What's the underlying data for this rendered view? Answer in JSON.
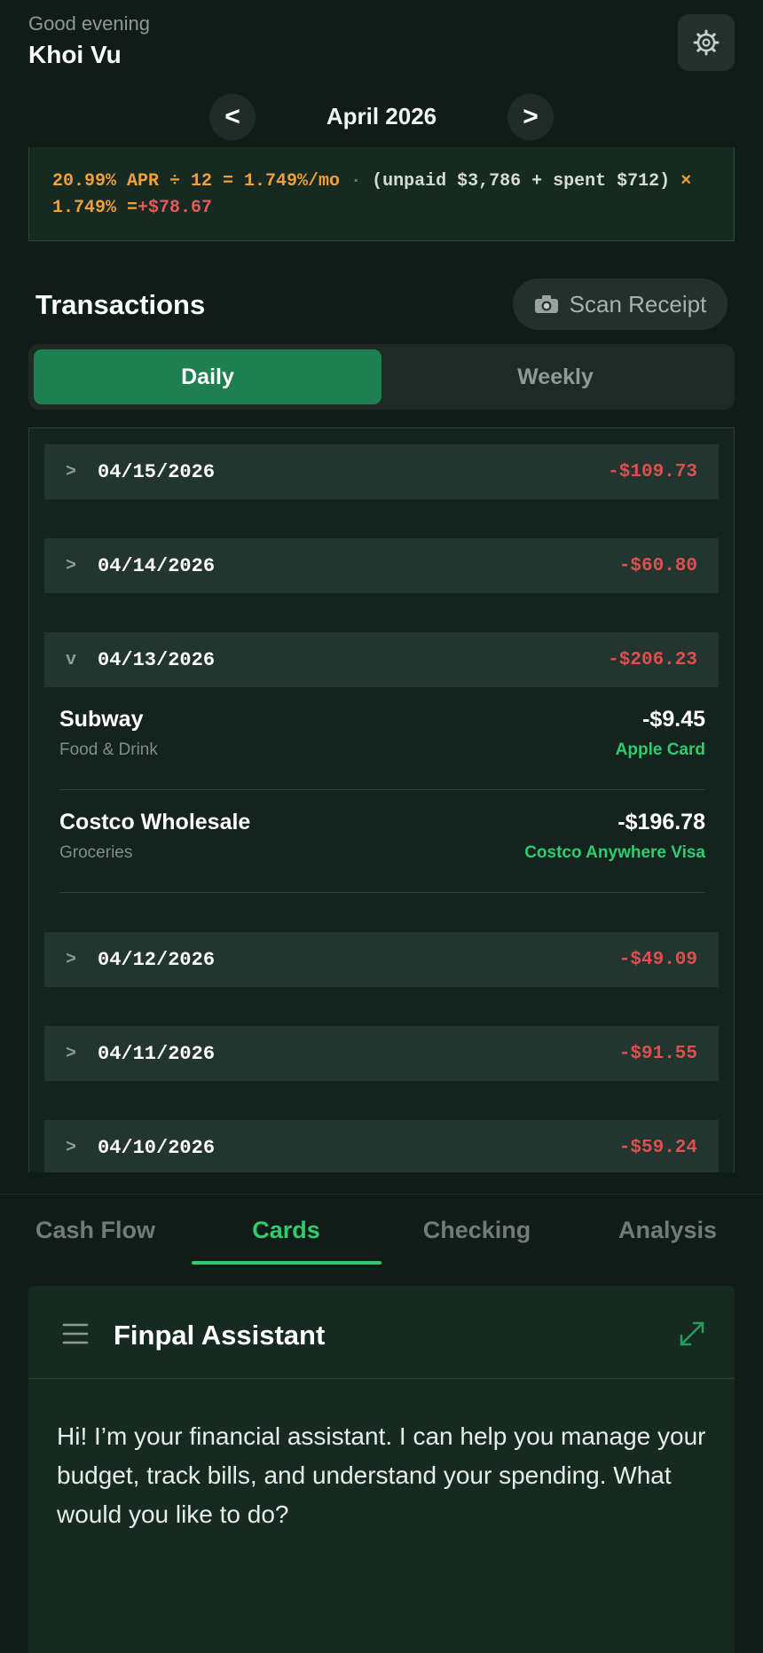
{
  "header": {
    "greeting": "Good evening",
    "user_name": "Khoi Vu",
    "settings_icon": "gear-icon"
  },
  "month_nav": {
    "prev_label": "<",
    "month": "April 2026",
    "next_label": ">"
  },
  "apr_calc": {
    "rate_part": "20.99% APR ÷ 12 = 1.749%/mo",
    "separator": "·",
    "base_part": "(unpaid $3,786 + spent $712)",
    "times_sign": "×",
    "monthly_rate": "1.749% =",
    "result": "+$78.67"
  },
  "transactions": {
    "title": "Transactions",
    "scan_icon": "camera-icon",
    "scan_label": "Scan Receipt",
    "views": [
      "Daily",
      "Weekly"
    ],
    "active_view": "Daily",
    "days": [
      {
        "chevron": ">",
        "date": "04/15/2026",
        "total": "-$109.73",
        "expanded": false
      },
      {
        "chevron": ">",
        "date": "04/14/2026",
        "total": "-$60.80",
        "expanded": false
      },
      {
        "chevron": "v",
        "date": "04/13/2026",
        "total": "-$206.23",
        "expanded": true,
        "items": [
          {
            "name": "Subway",
            "category": "Food & Drink",
            "amount": "-$9.45",
            "card": "Apple Card"
          },
          {
            "name": "Costco Wholesale",
            "category": "Groceries",
            "amount": "-$196.78",
            "card": "Costco Anywhere Visa"
          }
        ]
      },
      {
        "chevron": ">",
        "date": "04/12/2026",
        "total": "-$49.09",
        "expanded": false
      },
      {
        "chevron": ">",
        "date": "04/11/2026",
        "total": "-$91.55",
        "expanded": false
      },
      {
        "chevron": ">",
        "date": "04/10/2026",
        "total": "-$59.24",
        "expanded": false
      }
    ]
  },
  "tabs": {
    "items": [
      "Cash Flow",
      "Cards",
      "Checking",
      "Analysis"
    ],
    "active": "Cards"
  },
  "assistant": {
    "menu_icon": "hamburger-menu-icon",
    "title": "Finpal Assistant",
    "expand_icon": "expand-icon",
    "message": "Hi! I’m your financial assistant. I can help you manage your budget, track bills, and understand your spending. What would you like to do?"
  },
  "colors": {
    "background": "#101c18",
    "accent_green": "#2ecc71",
    "active_segment": "#1e8050",
    "negative_red": "#e04f4f",
    "apr_orange": "#f0a03a"
  }
}
